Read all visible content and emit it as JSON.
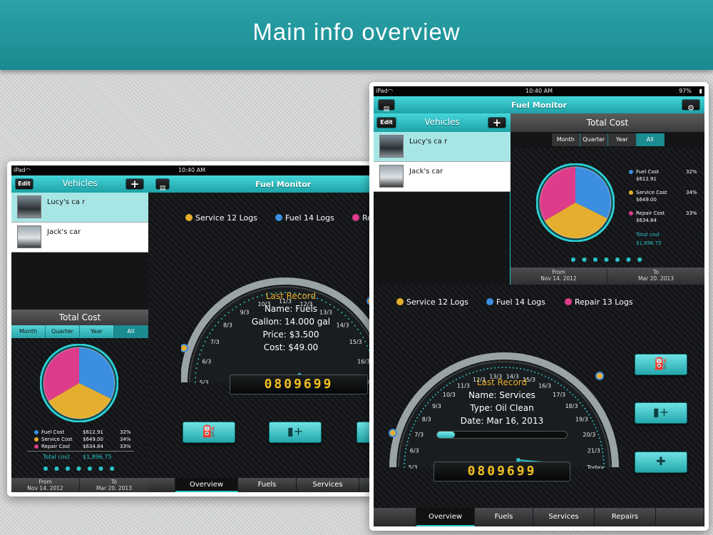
{
  "banner": {
    "title": "Main info overview"
  },
  "status": {
    "device": "iPad",
    "time": "10:40 AM",
    "battery": "97%"
  },
  "app": {
    "title": "Fuel Monitor"
  },
  "vehicles": {
    "title": "Vehicles",
    "edit": "Edit",
    "add": "+",
    "items": [
      {
        "name": "Lucy's ca r"
      },
      {
        "name": "Jack's car"
      }
    ]
  },
  "total_cost": {
    "title": "Total Cost",
    "segments": [
      "Month",
      "Quarter",
      "Year",
      "All"
    ],
    "selected": "All",
    "rows": [
      {
        "label": "Fuel Cost",
        "value": "$612.91",
        "pct": "32%",
        "color": "#3b8ee0"
      },
      {
        "label": "Service Cost",
        "value": "$649.00",
        "pct": "34%",
        "color": "#e6ae2e"
      },
      {
        "label": "Repair Cost",
        "value": "$634.84",
        "pct": "33%",
        "color": "#df3b8b"
      }
    ],
    "total_label": "Total cost",
    "total_value": "$1,896.75",
    "dots": "● ● ● ● ● ● ●",
    "from_label": "From",
    "from_date": "Nov 14. 2012",
    "to_label": "To",
    "to_date": "Mar 20. 2013"
  },
  "chart_data": {
    "type": "pie",
    "title": "Total Cost",
    "categories": [
      "Fuel Cost",
      "Service Cost",
      "Repair Cost"
    ],
    "values": [
      612.91,
      649.0,
      634.84
    ],
    "percent": [
      32,
      34,
      33
    ]
  },
  "logs": {
    "service": "Service 12 Logs",
    "fuel": "Fuel 14 Logs",
    "repair": "Repair 13 Logs",
    "service_color": "#e6ae2e",
    "fuel_color": "#3b8ee0",
    "repair_color": "#df3b8b"
  },
  "gauge_left": {
    "ticks": [
      "5/3",
      "6/3",
      "7/3",
      "8/3",
      "9/3",
      "10/3",
      "11/3",
      "12/3",
      "13/3",
      "14/3",
      "15/3",
      "16/3",
      "17/3"
    ],
    "heading": "Last Record",
    "line1": "Name: Fuels",
    "line2": "Gallon: 14.000 gal",
    "line3": "Price: $3.500",
    "line4": "Cost: $49.00",
    "odometer": "0809699"
  },
  "gauge_right": {
    "ticks": [
      "5/3",
      "6/3",
      "7/3",
      "8/3",
      "9/3",
      "10/3",
      "11/3",
      "12/3",
      "13/3",
      "14/3",
      "15/3",
      "16/3",
      "17/3",
      "18/3",
      "19/3",
      "20/3",
      "21/3",
      "Today"
    ],
    "heading": "Last Record",
    "line1": "Name: Services",
    "line2": "Type: Oil Clean",
    "line3": "Date: Mar 16, 2013",
    "odometer": "0809699"
  },
  "tabs": [
    "Overview",
    "Fuels",
    "Services",
    "Repairs"
  ],
  "active_tab": "Overview",
  "icons": {
    "add_fuel": "fuel-pump-add-icon",
    "add_service": "jerrycan-add-icon",
    "add_repair": "wrench-add-icon",
    "settings": "gear-icon",
    "menu": "document-icon"
  }
}
